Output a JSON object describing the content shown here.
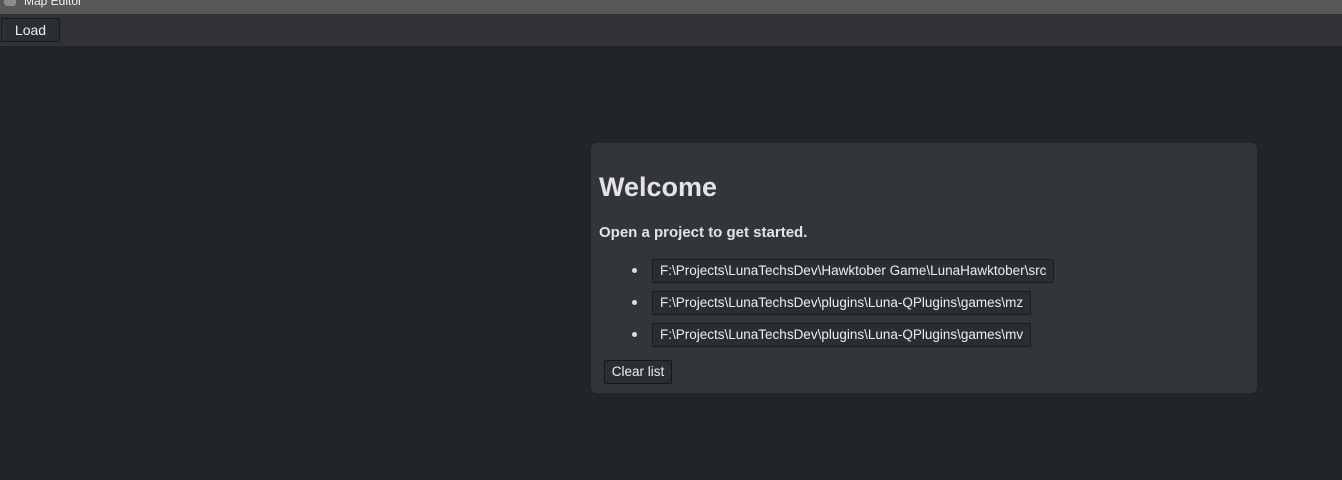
{
  "window": {
    "title": "Map Editor",
    "icon": "app-icon"
  },
  "toolbar": {
    "load_label": "Load"
  },
  "welcome": {
    "heading": "Welcome",
    "subtitle": "Open a project to get started.",
    "recent_projects": [
      "F:\\Projects\\LunaTechsDev\\Hawktober Game\\LunaHawktober\\src",
      "F:\\Projects\\LunaTechsDev\\plugins\\Luna-QPlugins\\games\\mz",
      "F:\\Projects\\LunaTechsDev\\plugins\\Luna-QPlugins\\games\\mv"
    ],
    "clear_label": "Clear list"
  },
  "colors": {
    "background": "#222528",
    "toolbar": "#303236",
    "panel": "#323539",
    "titlebar": "#5a5856"
  }
}
